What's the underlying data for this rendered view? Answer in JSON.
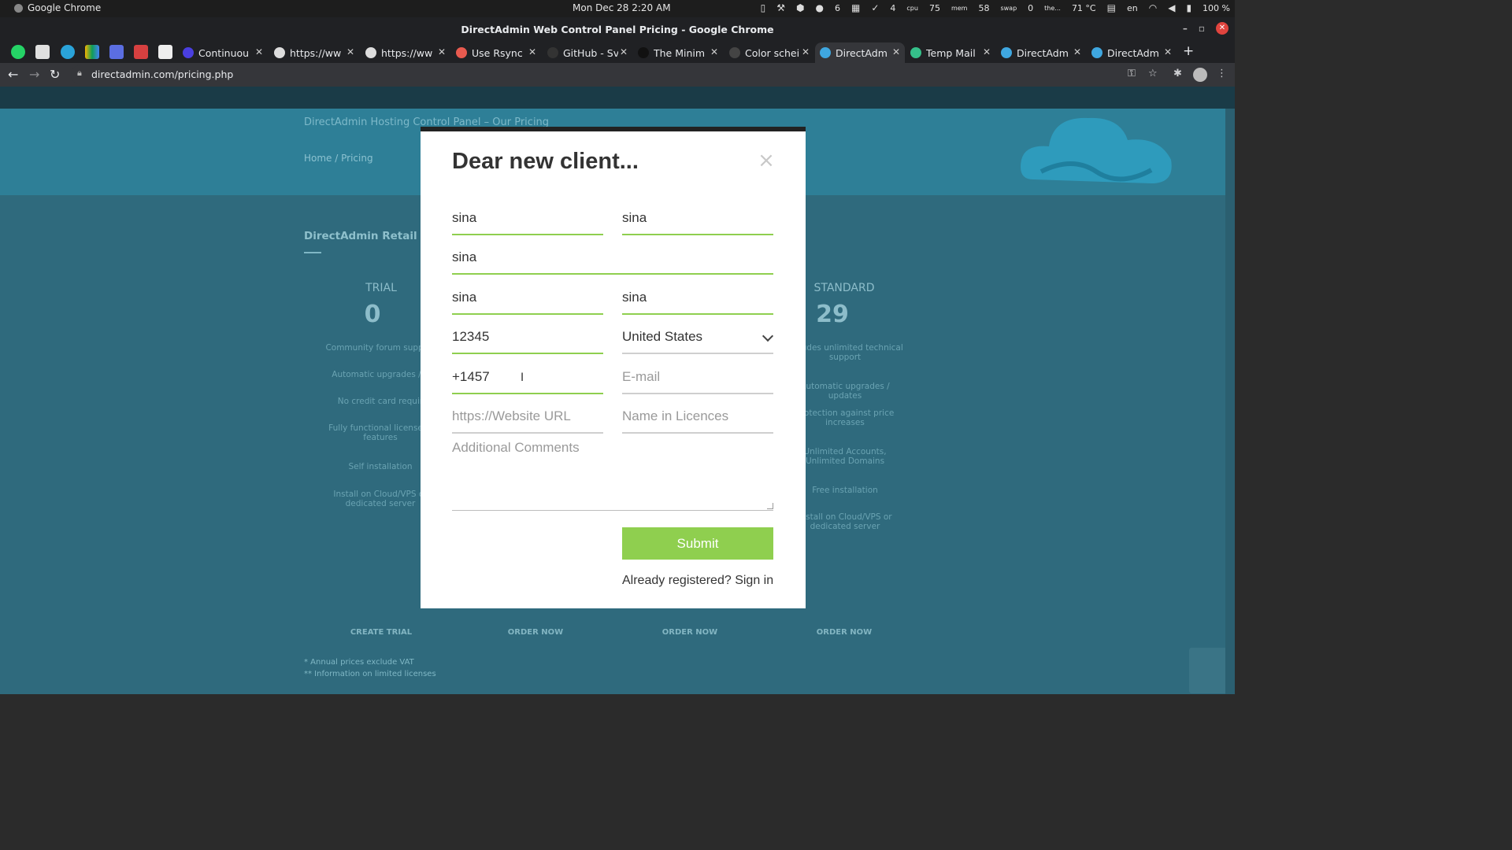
{
  "os": {
    "app_name": "Google Chrome",
    "clock": "Mon Dec 28  2:20 AM",
    "tray": [
      "6",
      "4",
      "75",
      "%",
      "58",
      "%",
      "0",
      "%",
      "71 °C",
      "en",
      "100 %"
    ],
    "tray_labels": [
      "cpu",
      "mem",
      "swap",
      "the..."
    ]
  },
  "window": {
    "title": "DirectAdmin Web Control Panel Pricing - Google Chrome"
  },
  "tabs": [
    {
      "label": "Continuou",
      "fav_color": "#4a3fe0"
    },
    {
      "label": "https://ww",
      "fav_color": "#dddddd"
    },
    {
      "label": "https://ww",
      "fav_color": "#dddddd"
    },
    {
      "label": "Use Rsync",
      "fav_color": "#e85a4f"
    },
    {
      "label": "GitHub - Sv",
      "fav_color": "#333333"
    },
    {
      "label": "The Minim",
      "fav_color": "#111111"
    },
    {
      "label": "Color schei",
      "fav_color": "#444444"
    },
    {
      "label": "DirectAdm",
      "fav_color": "#3fa7e0"
    },
    {
      "label": "Temp Mail",
      "fav_color": "#35c08a"
    },
    {
      "label": "DirectAdm",
      "fav_color": "#3fa7e0"
    },
    {
      "label": "DirectAdm",
      "fav_color": "#3fa7e0"
    }
  ],
  "address": {
    "url": "directadmin.com/pricing.php"
  },
  "background_page": {
    "hero_subtitle": "DirectAdmin Hosting Control Panel – Our Pricing",
    "breadcrumbs": "Home / Pricing",
    "section_title": "DirectAdmin Retail Lic",
    "plans": [
      {
        "name": "TRIAL",
        "price": "0"
      },
      {
        "name": "STANDARD",
        "price": "29"
      }
    ],
    "trial_features": [
      "Community forum support",
      "Automatic upgrades / u",
      "No credit card requir",
      "Fully functional license w features",
      "Self installation",
      "Install on Cloud/VPS or dedicated server"
    ],
    "standard_features": [
      "Includes unlimited technical support",
      "Automatic upgrades / updates",
      "Protection against price increases",
      "Unlimited Accounts, Unlimited Domains",
      "Free installation",
      "Install on Cloud/VPS or dedicated server"
    ],
    "order_buttons": [
      "CREATE TRIAL",
      "ORDER NOW",
      "ORDER NOW",
      "ORDER NOW"
    ],
    "footer_note_1": "* Annual prices exclude VAT",
    "footer_note_2": "** Information on limited licenses"
  },
  "modal": {
    "title": "Dear new client...",
    "close_glyph": "×",
    "fields": {
      "first_name": "sina",
      "last_name": "sina",
      "company": "sina",
      "address": "sina",
      "city": "sina",
      "zip": "12345",
      "country": "United States",
      "phone": "+1457",
      "email_placeholder": "E-mail",
      "website_placeholder": "https://Website URL",
      "licence_name_placeholder": "Name in Licences",
      "comments_placeholder": "Additional Comments"
    },
    "submit_label": "Submit",
    "signin_text": "Already registered? Sign in"
  },
  "colors": {
    "accent_green": "#8fcf4f",
    "page_overlay": "#2f6a7d"
  }
}
